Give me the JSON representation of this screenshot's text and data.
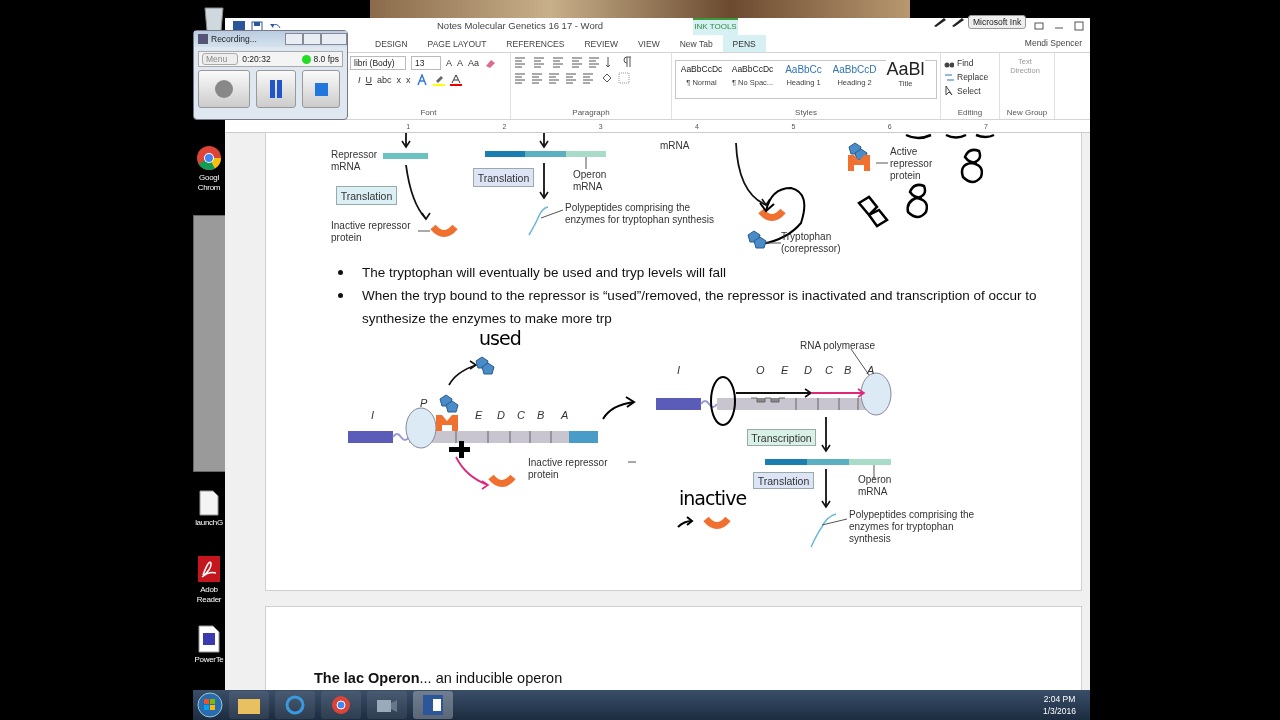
{
  "desktop": {
    "icons": [
      {
        "label": "Googl Chrom",
        "kind": "chrome"
      },
      {
        "label": "launchG",
        "kind": "file"
      },
      {
        "label": "Adob Reader",
        "kind": "pdf"
      },
      {
        "label": "PowerTe",
        "kind": "ppt"
      }
    ]
  },
  "word": {
    "title": "Notes Molecular Genetics 16 17 - Word",
    "contextual": "INK TOOLS",
    "ink_toolbar": "Microsoft Ink",
    "user": "Mendi Spencer",
    "tabs": [
      {
        "label": "DESIGN",
        "selected": false
      },
      {
        "label": "PAGE LAYOUT",
        "selected": false
      },
      {
        "label": "REFERENCES",
        "selected": false
      },
      {
        "label": "REVIEW",
        "selected": false
      },
      {
        "label": "VIEW",
        "selected": false
      },
      {
        "label": "New Tab",
        "selected": false
      },
      {
        "label": "PENS",
        "selected": true
      }
    ],
    "ribbon": {
      "font_name": "libri (Body)",
      "font_size": "13",
      "font_buttons": [
        "A",
        "A",
        "Aa"
      ],
      "format_buttons": [
        "I",
        "U",
        "abc",
        "x",
        "x"
      ],
      "styles": [
        {
          "preview": "AaBbCcDc",
          "name": "¶ Normal",
          "kind": "body"
        },
        {
          "preview": "AaBbCcDc",
          "name": "¶ No Spac...",
          "kind": "body"
        },
        {
          "preview": "AaBbCc",
          "name": "Heading 1",
          "kind": "heading"
        },
        {
          "preview": "AaBbCcD",
          "name": "Heading 2",
          "kind": "heading"
        },
        {
          "preview": "AaBl",
          "name": "Title",
          "kind": "title"
        }
      ],
      "editing": [
        "Find",
        "Replace",
        "Select"
      ],
      "text_direction": "Text Direction",
      "groups": [
        "Font",
        "Paragraph",
        "Styles",
        "Editing",
        "New Group"
      ]
    },
    "ruler": [
      "1",
      "2",
      "3",
      "4",
      "5",
      "6",
      "7"
    ]
  },
  "document": {
    "top_figure": {
      "labels": [
        "Repressor mRNA",
        "Inactive repressor protein",
        "mRNA",
        "Operon mRNA",
        "Polypeptides comprising the enzymes for tryptophan synthesis",
        "Tryptophan (corepressor)",
        "Active repressor protein"
      ],
      "boxes": [
        "Translation",
        "Translation"
      ]
    },
    "bullets": [
      "The tryptophan will eventually be used and tryp levels will fall",
      "When the tryp bound to the repressor is “used”/removed, the repressor is inactivated and transcription of occur to synthesize the enzymes to make more trp"
    ],
    "bottom_figure": {
      "handwriting": [
        "used",
        "inactive"
      ],
      "left_genes": [
        "I",
        "P",
        "E",
        "D",
        "C",
        "B",
        "A"
      ],
      "right_genes": [
        "I",
        "O",
        "E",
        "D",
        "C",
        "B",
        "A"
      ],
      "labels": [
        "Inactive repressor protein",
        "RNA polymerase",
        "Operon mRNA",
        "Polypeptides comprising the enzymes for tryptophan synthesis"
      ],
      "boxes": [
        "Transcription",
        "Translation"
      ]
    },
    "next_page": "**The lac Operon**... an inducible operon"
  },
  "recorder": {
    "title": "Recording...",
    "menu": "Menu",
    "time": "0:20:32",
    "fps": "8.0 fps"
  },
  "taskbar": {
    "time": "2:04 PM",
    "date": "1/3/2016"
  }
}
